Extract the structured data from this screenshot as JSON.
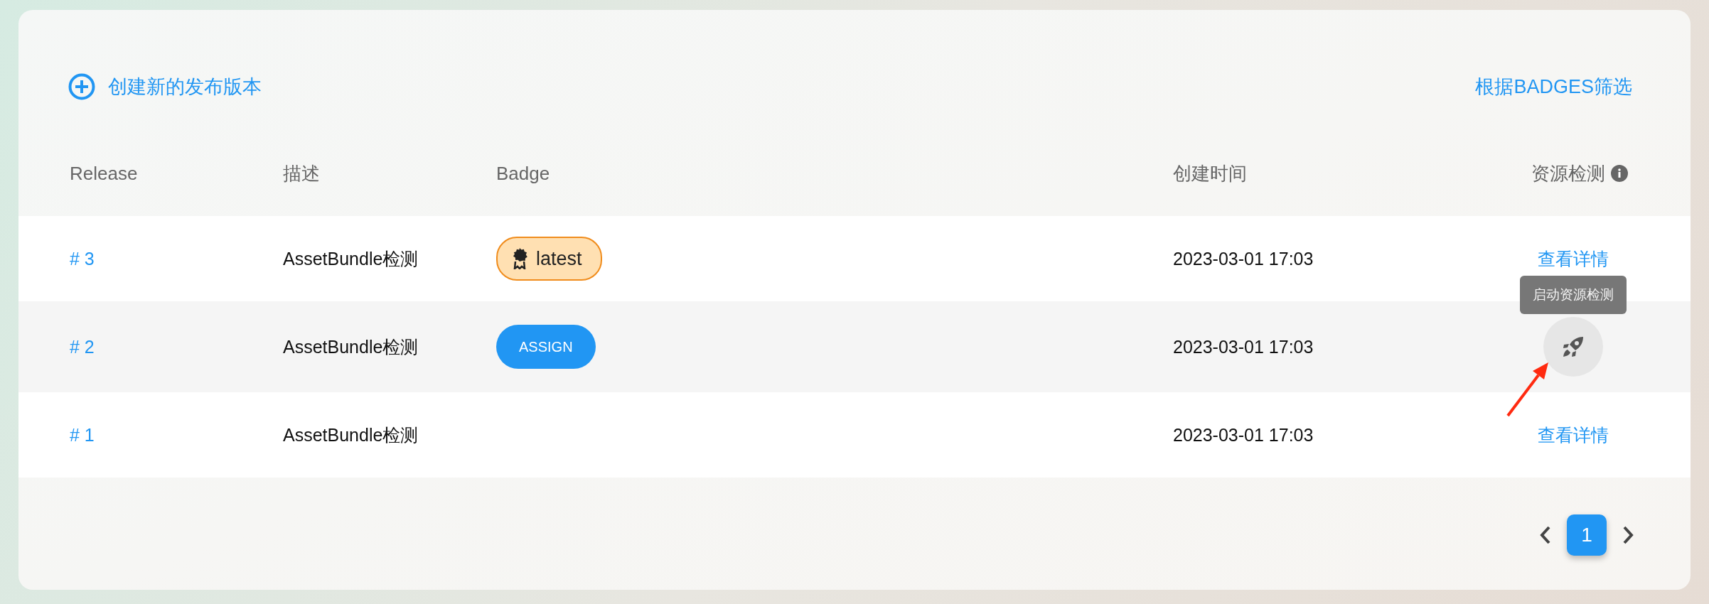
{
  "toolbar": {
    "create_label": "创建新的发布版本",
    "filter_label": "根据BADGES筛选"
  },
  "table": {
    "columns": [
      "Release",
      "描述",
      "Badge",
      "创建时间",
      "资源检测"
    ],
    "rows": [
      {
        "release": "# 3",
        "description": "AssetBundle检测",
        "badge": {
          "kind": "latest",
          "label": "latest"
        },
        "created": "2023-03-01 17:03",
        "action": {
          "kind": "link",
          "label": "查看详情"
        }
      },
      {
        "release": "# 2",
        "description": "AssetBundle检测",
        "badge": {
          "kind": "assign",
          "label": "ASSIGN"
        },
        "created": "2023-03-01 17:03",
        "action": {
          "kind": "launch",
          "tooltip": "启动资源检测"
        }
      },
      {
        "release": "# 1",
        "description": "AssetBundle检测",
        "created": "2023-03-01 17:03",
        "action": {
          "kind": "link",
          "label": "查看详情"
        }
      }
    ]
  },
  "pagination": {
    "pages": [
      {
        "label": "1",
        "selected": true
      }
    ]
  }
}
